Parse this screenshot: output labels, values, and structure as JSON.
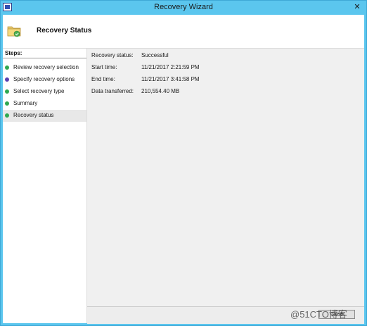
{
  "window": {
    "title": "Recovery Wizard",
    "close_glyph": "✕"
  },
  "header": {
    "title": "Recovery Status",
    "icon": "folder-restore-icon"
  },
  "sidebar": {
    "heading": "Steps:",
    "items": [
      {
        "label": "Review recovery selection",
        "status_color": "#2fa84f"
      },
      {
        "label": "Specify recovery options",
        "status_color": "#5a3fb0"
      },
      {
        "label": "Select recovery type",
        "status_color": "#2fa84f"
      },
      {
        "label": "Summary",
        "status_color": "#2fa84f"
      },
      {
        "label": "Recovery status",
        "status_color": "#2fa84f",
        "active": true
      }
    ]
  },
  "status": {
    "recovery_status_label": "Recovery status:",
    "recovery_status_value": "Successful",
    "start_time_label": "Start time:",
    "start_time_value": "11/21/2017 2:21:59 PM",
    "end_time_label": "End time:",
    "end_time_value": "11/21/2017 3:41:58 PM",
    "data_transferred_label": "Data transferred:",
    "data_transferred_value": "210,554.40 MB"
  },
  "footer": {
    "close_label": "Close"
  },
  "watermark": {
    "text": "@51CTO博客"
  },
  "colors": {
    "titlebar": "#5bc6ee",
    "step_green": "#2fa84f",
    "step_purple": "#5a3fb0",
    "active_step_bg": "#e8e8e8"
  }
}
